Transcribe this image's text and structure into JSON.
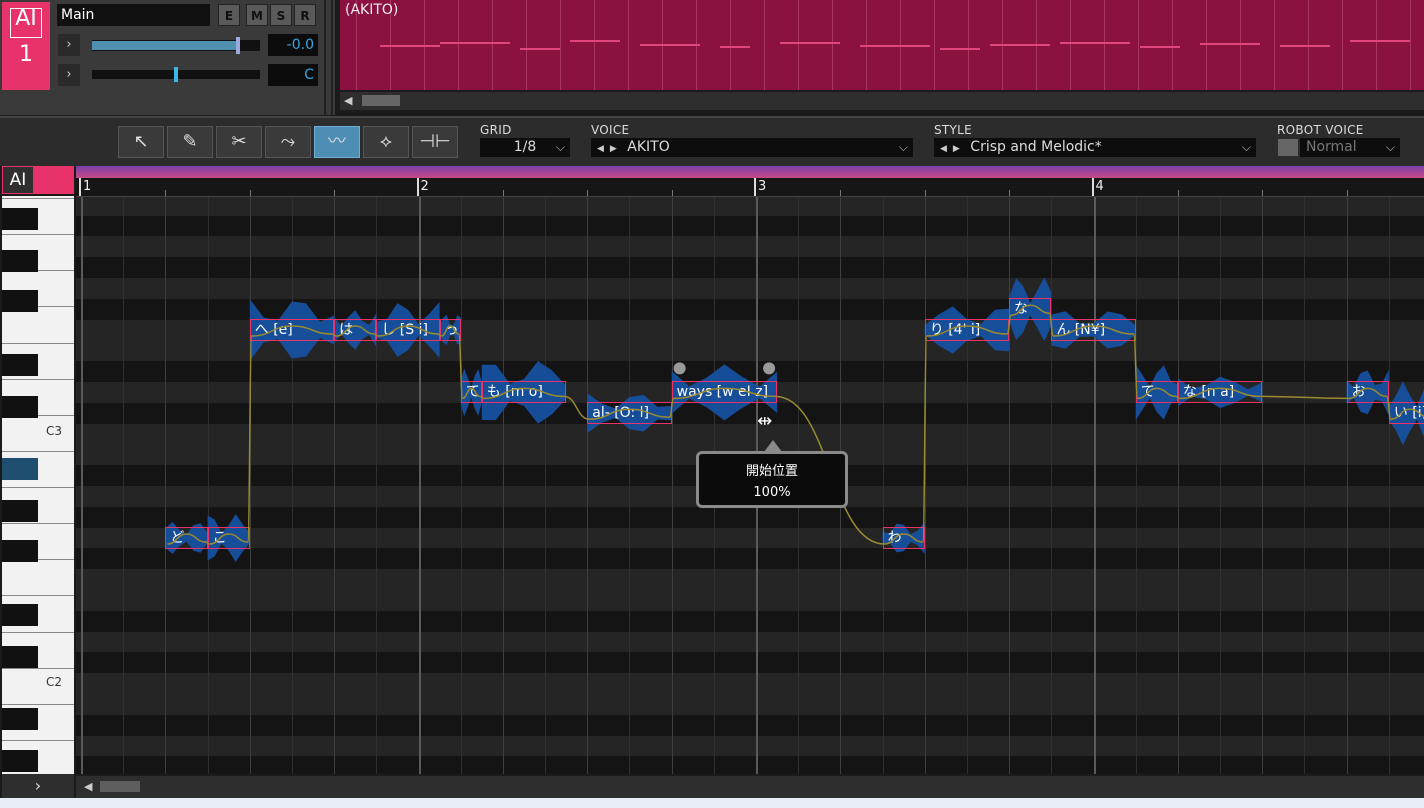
{
  "track": {
    "ai_label": "AI",
    "number": "1",
    "name": "Main",
    "buttons": [
      "E",
      "M",
      "S",
      "R"
    ],
    "volume_value": "-0.0",
    "volume_level": 0.87,
    "pan_value": "C",
    "pan_level": 0.5
  },
  "region": {
    "label": "(AKITO)"
  },
  "toolbar": {
    "tools": [
      {
        "name": "arrow-tool-icon",
        "glyph": "↖"
      },
      {
        "name": "pencil-tool-icon",
        "glyph": "✎"
      },
      {
        "name": "scissors-tool-icon",
        "glyph": "✂"
      },
      {
        "name": "pitch-tool-icon",
        "glyph": "⤳"
      },
      {
        "name": "vibrato-tool-icon",
        "glyph": "〰"
      },
      {
        "name": "dynamics-tool-icon",
        "glyph": "⟡"
      },
      {
        "name": "timing-tool-icon",
        "glyph": "⊣⊢"
      }
    ],
    "active_tool_index": 4,
    "grid_label": "GRID",
    "grid_value": "1/8",
    "voice_label": "VOICE",
    "voice_value": "AKITO",
    "style_label": "STYLE",
    "style_value": "Crisp and Melodic*",
    "robot_label": "ROBOT VOICE",
    "robot_value": "Normal"
  },
  "roll": {
    "ai_label": "AI",
    "c3_label": "C3",
    "c2_label": "C2",
    "bars": [
      "1",
      "2",
      "3",
      "4"
    ],
    "notes": [
      {
        "text": "ど",
        "start": 1.25,
        "len": 0.125,
        "pitch": "G2"
      },
      {
        "text": "こ",
        "start": 1.375,
        "len": 0.125,
        "pitch": "G2"
      },
      {
        "text": "へ [e]",
        "start": 1.5,
        "len": 0.25,
        "pitch": "F3"
      },
      {
        "text": "は",
        "start": 1.75,
        "len": 0.125,
        "pitch": "F3"
      },
      {
        "text": "し [S i]",
        "start": 1.875,
        "len": 0.1875,
        "pitch": "F3"
      },
      {
        "text": "っ",
        "start": 2.0625,
        "len": 0.0625,
        "pitch": "F3"
      },
      {
        "text": "て",
        "start": 2.125,
        "len": 0.0625,
        "pitch": "D3"
      },
      {
        "text": "も [m o]",
        "start": 2.1875,
        "len": 0.25,
        "pitch": "D3"
      },
      {
        "text": "al- [O: l]",
        "start": 2.5,
        "len": 0.25,
        "pitch": "C#3"
      },
      {
        "text": "ways [w eI z]",
        "start": 2.75,
        "len": 0.3125,
        "pitch": "D3"
      },
      {
        "text": "わ",
        "start": 3.375,
        "len": 0.125,
        "pitch": "G2"
      },
      {
        "text": "り [4' i]",
        "start": 3.5,
        "len": 0.25,
        "pitch": "F3"
      },
      {
        "text": "な",
        "start": 3.75,
        "len": 0.125,
        "pitch": "F#3"
      },
      {
        "text": "ん [N¥]",
        "start": 3.875,
        "len": 0.25,
        "pitch": "F3"
      },
      {
        "text": "て",
        "start": 4.125,
        "len": 0.125,
        "pitch": "D3"
      },
      {
        "text": "な [n a]",
        "start": 4.25,
        "len": 0.25,
        "pitch": "D3"
      },
      {
        "text": "お",
        "start": 4.75,
        "len": 0.125,
        "pitch": "D3"
      },
      {
        "text": "い [i]",
        "start": 4.875,
        "len": 0.125,
        "pitch": "C#3"
      }
    ]
  },
  "tooltip": {
    "title": "開始位置",
    "value": "100%"
  },
  "colors": {
    "accent": "#e8326a",
    "region": "#8b1240",
    "waveform": "#1650a0",
    "pitch_curve": "#9a8a30",
    "active_tool": "#4e8eb4"
  }
}
